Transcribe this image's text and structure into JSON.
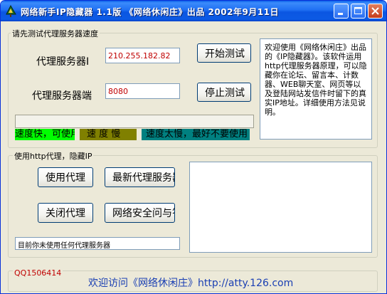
{
  "window": {
    "title": "网络新手IP隐藏器 1.1版 《网络休闲庄》出品 2002年9月11日"
  },
  "speed_test": {
    "group_label": "请先测试代理服务器速度",
    "server_label": "代理服务器I",
    "server_value": "210.255.182.82",
    "port_label": "代理服务器端",
    "port_value": "8080",
    "start_button": "开始测试",
    "stop_button": "停止测试",
    "intro_text": "欢迎使用《网络休闲庄》出品的《IP隐藏器》。该软件运用http代理服务器原理，可以隐藏你在论坛、留言本、计数器、WEB聊天室、网页等以及登陆网站发信件时留下的真实IP地址。详细使用方法见说明。",
    "speed_levels": [
      {
        "text": "速度快，可使用",
        "color": "#00ff00"
      },
      {
        "text": "速 度 慢",
        "color": "#808000"
      },
      {
        "text": "速度太慢，最好不要使用",
        "color": "#008080"
      }
    ]
  },
  "proxy": {
    "group_label": "使用http代理，隐藏IP",
    "use_button": "使用代理",
    "latest_button": "最新代理服务器",
    "close_button": "关闭代理",
    "security_button": "网络安全问与答",
    "status_text": "目前你未使用任何代理服务器"
  },
  "footer": {
    "qq": "QQ1506414",
    "visit_text": "欢迎访问《网络休闲庄》http://atty.126.com"
  },
  "icons": {
    "app": "app-icon",
    "minimize": "minimize-icon",
    "maximize": "maximize-icon",
    "close": "close-icon"
  }
}
